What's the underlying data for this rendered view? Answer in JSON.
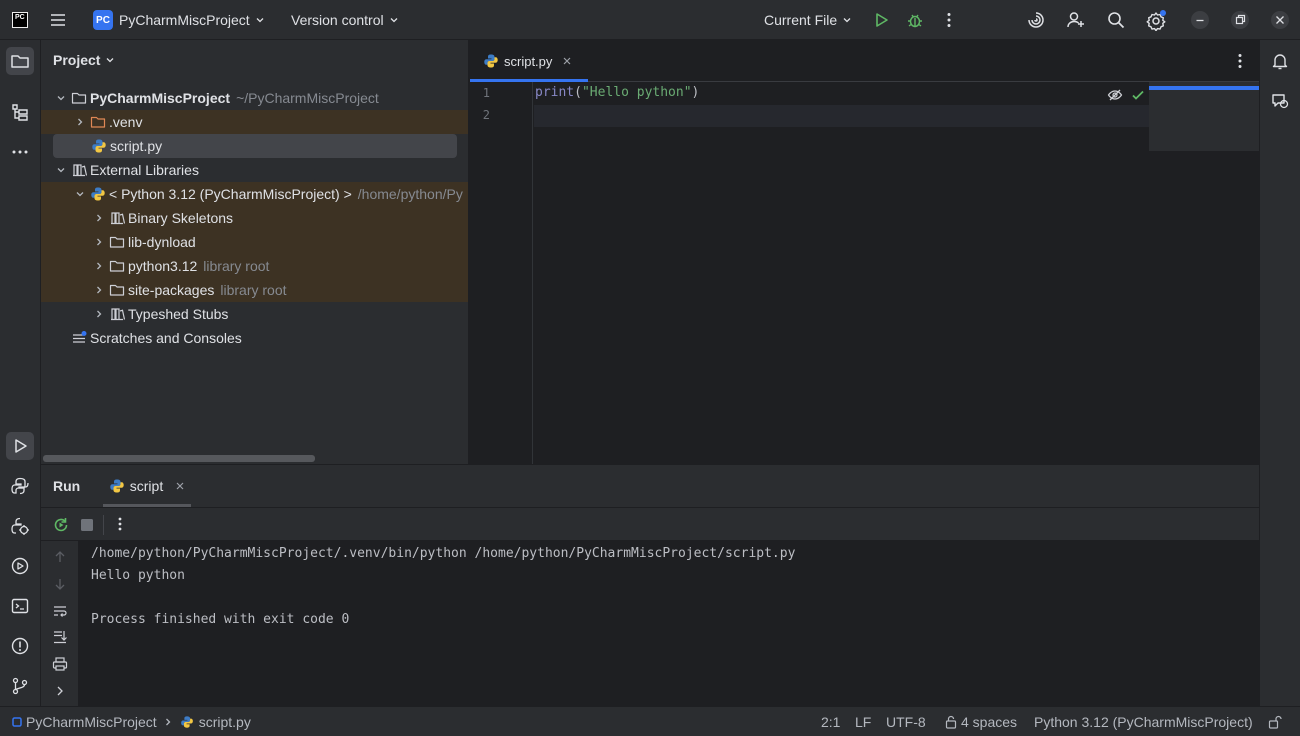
{
  "titlebar": {
    "app_logo": "PC",
    "project_badge": "PC",
    "project_name": "PyCharmMiscProject",
    "vcs_label": "Version control",
    "run_config": "Current File"
  },
  "project_panel": {
    "title": "Project",
    "root": {
      "name": "PyCharmMiscProject",
      "path": "~/PyCharmMiscProject"
    },
    "venv": ".venv",
    "script": "script.py",
    "external_libraries": "External Libraries",
    "python_sdk": {
      "name": "< Python 3.12 (PyCharmMiscProject) >",
      "path": "/home/python/Py"
    },
    "lib_items": [
      {
        "name": "Binary Skeletons",
        "note": ""
      },
      {
        "name": "lib-dynload",
        "note": ""
      },
      {
        "name": "python3.12",
        "note": "library root"
      },
      {
        "name": "site-packages",
        "note": "library root"
      },
      {
        "name": "Typeshed Stubs",
        "note": ""
      }
    ],
    "scratches": "Scratches and Consoles"
  },
  "editor": {
    "tab_label": "script.py",
    "lines": [
      {
        "number": "1",
        "func": "print",
        "open": "(",
        "string": "\"Hello python\"",
        "close": ")"
      },
      {
        "number": "2"
      }
    ]
  },
  "run": {
    "title": "Run",
    "tab_label": "script",
    "console": [
      "/home/python/PyCharmMiscProject/.venv/bin/python /home/python/PyCharmMiscProject/script.py",
      "Hello python",
      "",
      "Process finished with exit code 0"
    ]
  },
  "statusbar": {
    "breadcrumb_project": "PyCharmMiscProject",
    "breadcrumb_file": "script.py",
    "position": "2:1",
    "line_separator": "LF",
    "encoding": "UTF-8",
    "indent": "4 spaces",
    "interpreter": "Python 3.12 (PyCharmMiscProject)"
  },
  "colors": {
    "accent": "#3574f0",
    "run_green": "#5fb865",
    "library_bg": "#3d3223",
    "string": "#6aab73"
  }
}
